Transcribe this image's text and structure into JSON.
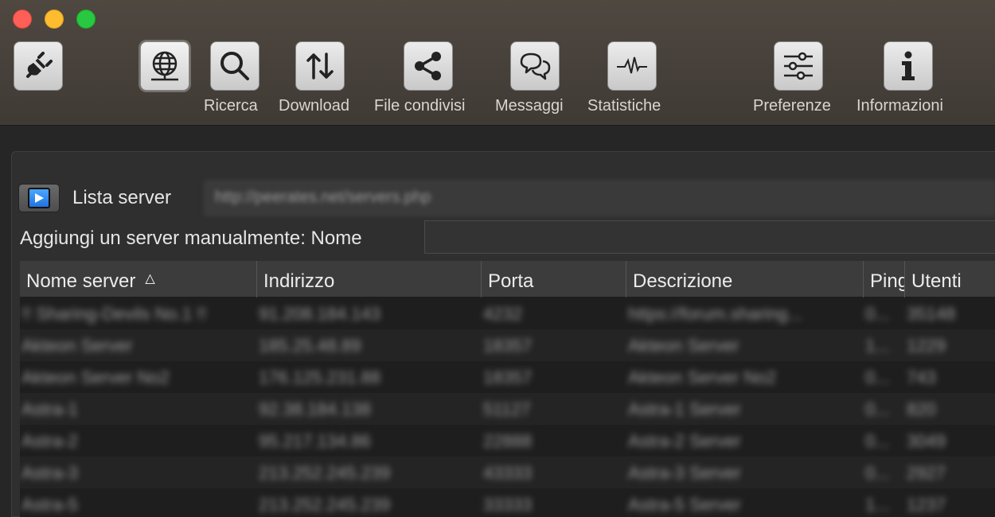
{
  "toolbar": {
    "items": [
      {
        "label": "",
        "icon": "plug-icon"
      },
      {
        "label": "",
        "icon": "globe-icon"
      },
      {
        "label": "Ricerca",
        "icon": "search-icon"
      },
      {
        "label": "Download",
        "icon": "arrows-updown-icon"
      },
      {
        "label": "File condivisi",
        "icon": "share-icon"
      },
      {
        "label": "Messaggi",
        "icon": "chat-icon"
      },
      {
        "label": "Statistiche",
        "icon": "pulse-icon"
      },
      {
        "label": "Preferenze",
        "icon": "sliders-icon"
      },
      {
        "label": "Informazioni",
        "icon": "info-icon"
      }
    ]
  },
  "server_list": {
    "label": "Lista server",
    "url": "http://peerates.net/servers.php"
  },
  "manual_add": {
    "label": "Aggiungi un server manualmente: Nome",
    "name_value": ""
  },
  "table": {
    "columns": [
      "Nome server",
      "Indirizzo",
      "Porta",
      "Descrizione",
      "Ping",
      "Utenti"
    ],
    "sorted_column": "Nome server",
    "rows": [
      [
        "!! Sharing-Devils No.1 !!",
        "91.208.184.143",
        "4232",
        "https://forum.sharing...",
        "0...",
        "35148"
      ],
      [
        "Akteon Server",
        "185.25.48.89",
        "18357",
        "Akteon Server",
        "1...",
        "1229"
      ],
      [
        "Akteon Server No2",
        "176.125.231.88",
        "18357",
        "Akteon Server No2",
        "0...",
        "743"
      ],
      [
        "Astra-1",
        "92.38.184.138",
        "51127",
        "Astra-1 Server",
        "0...",
        "820"
      ],
      [
        "Astra-2",
        "95.217.134.86",
        "22888",
        "Astra-2 Server",
        "0...",
        "3049"
      ],
      [
        "Astra-3",
        "213.252.245.239",
        "43333",
        "Astra-3 Server",
        "0...",
        "2927"
      ],
      [
        "Astra-5",
        "213.252.245.239",
        "33333",
        "Astra-5 Server",
        "1...",
        "1237"
      ]
    ]
  },
  "colors": {
    "toolbar_bg": "#4a433d",
    "panel_bg": "#2f2f2f",
    "table_bg": "#1e1e1e",
    "header_bg": "#3c3c3c",
    "play_accent": "#1f72e0"
  }
}
